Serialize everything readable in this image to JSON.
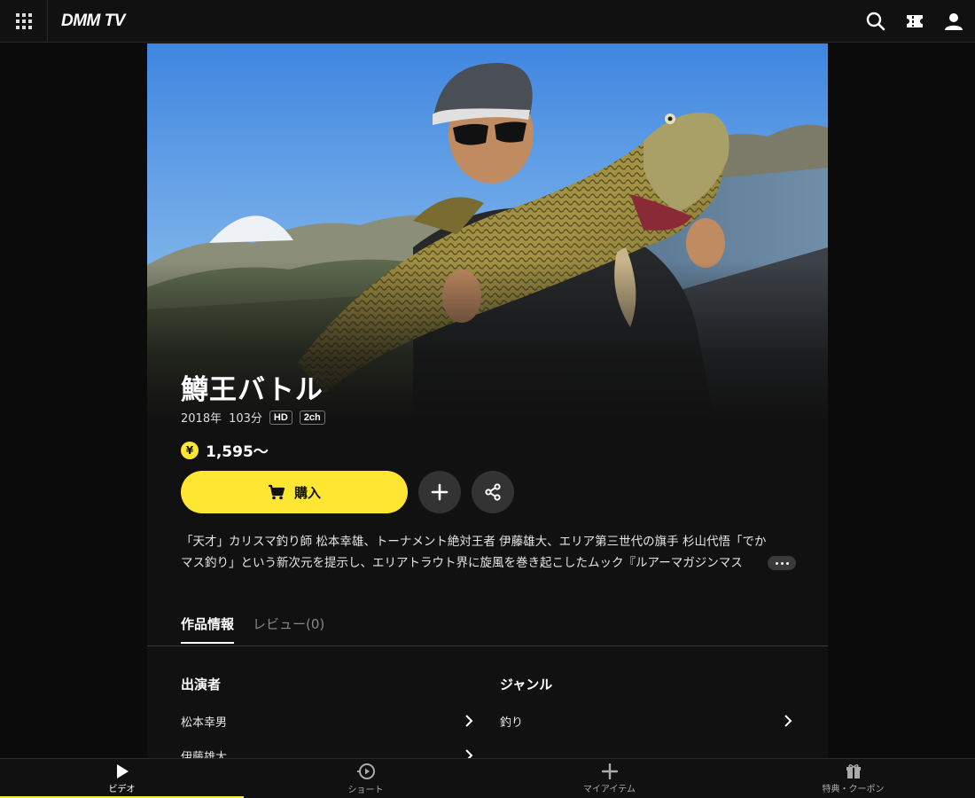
{
  "header": {
    "logo": "DMM TV",
    "icons": [
      "menu-grid-icon",
      "search-icon",
      "ticket-icon",
      "user-icon"
    ]
  },
  "content": {
    "title": "鱒王バトル",
    "year": "2018年",
    "duration": "103分",
    "badges": [
      "HD",
      "2ch"
    ],
    "price": "1,595～",
    "price_icon": "¥",
    "buy_label": "購入",
    "description_line1": "「天才」カリスマ釣り師 松本幸雄、トーナメント絶対王者 伊藤雄大、エリア第三世代の旗手 杉山代悟「でか",
    "description_line2": "マス釣り」という新次元を提示し、エリアトラウト界に旋風を巻き起こしたムック『ルアーマガジンマス"
  },
  "tabs": {
    "info": "作品情報",
    "review": "レビュー(0)"
  },
  "cast": {
    "heading": "出演者",
    "items": [
      "松本幸男",
      "伊藤雄大"
    ]
  },
  "genre": {
    "heading": "ジャンル",
    "items": [
      "釣り"
    ]
  },
  "bottom_nav": {
    "items": [
      {
        "label": "ビデオ",
        "icon": "play-icon"
      },
      {
        "label": "ショート",
        "icon": "short-play-icon"
      },
      {
        "label": "マイアイテム",
        "icon": "plus-icon"
      },
      {
        "label": "特典・クーポン",
        "icon": "gift-icon"
      }
    ]
  },
  "colors": {
    "accent": "#ffe633",
    "background": "#0b0b0b",
    "panel": "#111111"
  }
}
